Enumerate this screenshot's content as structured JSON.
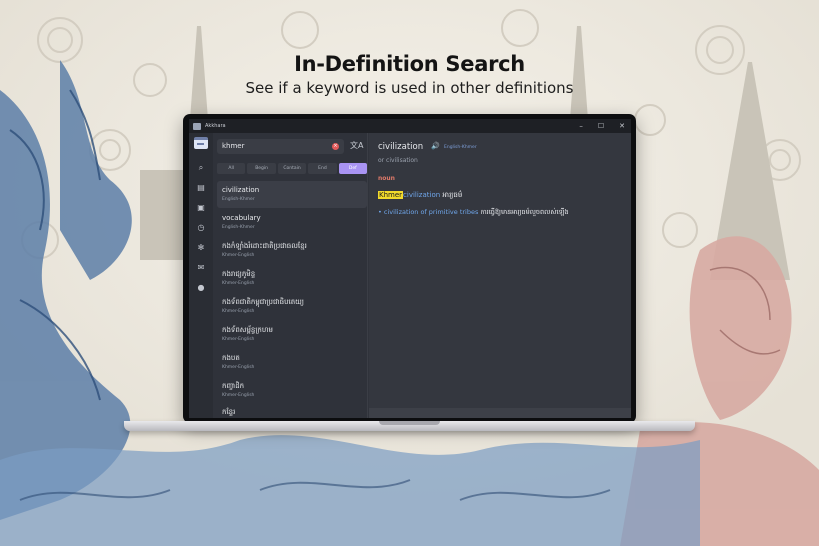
{
  "heading": "In-Definition Search",
  "subheading": "See if a keyword is used in other definitions",
  "window": {
    "title": "Akkhara",
    "controls": [
      "–",
      "☐",
      "✕"
    ]
  },
  "search": {
    "value": "khmer",
    "tabs": [
      "All",
      "Begin",
      "Contain",
      "End",
      "Def"
    ],
    "active_tab": "Def"
  },
  "results": [
    {
      "word": "civilization",
      "lang": "English-Khmer"
    },
    {
      "word": "vocabulary",
      "lang": "English-Khmer"
    },
    {
      "word": "កងកំឡាំងរំដោះជាតិប្រជាធលខ្មែរ",
      "lang": "Khmer-English"
    },
    {
      "word": "កងរាជ្យភូមិន្ទ",
      "lang": "Khmer-English"
    },
    {
      "word": "កងទ័ពជាតិកម្ពុជាប្រជាធិបតេយ្យ",
      "lang": "Khmer-English"
    },
    {
      "word": "កងទ័ពសម្ព័ន្ធក្រហម",
      "lang": "Khmer-English"
    },
    {
      "word": "កងបត",
      "lang": "Khmer-English"
    },
    {
      "word": "កញ្ចាដិក",
      "lang": "Khmer-English"
    },
    {
      "word": "កន្ទែរ",
      "lang": "Khmer-English"
    }
  ],
  "entry": {
    "headword": "civilization",
    "dictionary": "English-Khmer",
    "variant": "or civilisation",
    "pos": "noun",
    "highlight": "Khmer",
    "definition_link": "civilization",
    "definition_text": "អារ្យធម៌",
    "example_link": "civilization of primitive tribes",
    "example_text": "ការធ្វើឱ្យមានអារ្យធម៌លួចពលស់ឡើង"
  },
  "colors": {
    "accent": "#a994f3",
    "highlight": "#f2da2b",
    "link": "#6fa6ea",
    "pos": "#e07a6a"
  }
}
